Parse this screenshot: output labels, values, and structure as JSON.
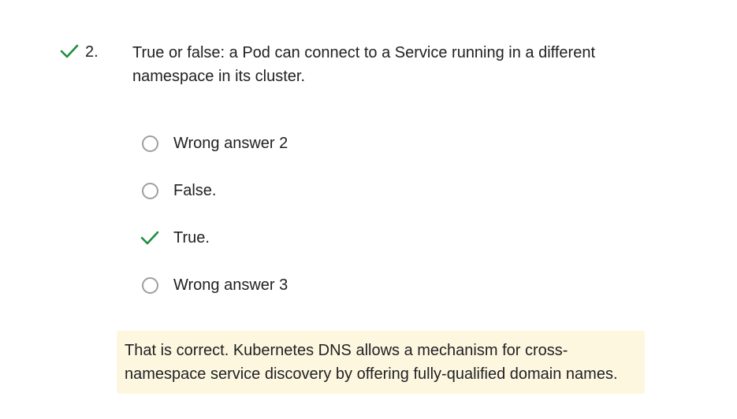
{
  "question": {
    "number": "2.",
    "status": "correct",
    "status_icon": "check-icon",
    "text": "True or false: a Pod can connect to a Service running in a different namespace in its cluster."
  },
  "options": [
    {
      "label": "Wrong answer 2",
      "state": "unselected"
    },
    {
      "label": "False.",
      "state": "unselected"
    },
    {
      "label": "True.",
      "state": "selected-correct"
    },
    {
      "label": "Wrong answer 3",
      "state": "unselected"
    }
  ],
  "feedback": {
    "text": "That is correct. Kubernetes DNS allows a mechanism for cross-namespace service discovery by offering fully-qualified domain names."
  },
  "colors": {
    "check": "#1e8e3e",
    "radio_border": "#9e9e9e",
    "feedback_bg": "#fef7e0",
    "text": "#202124"
  }
}
